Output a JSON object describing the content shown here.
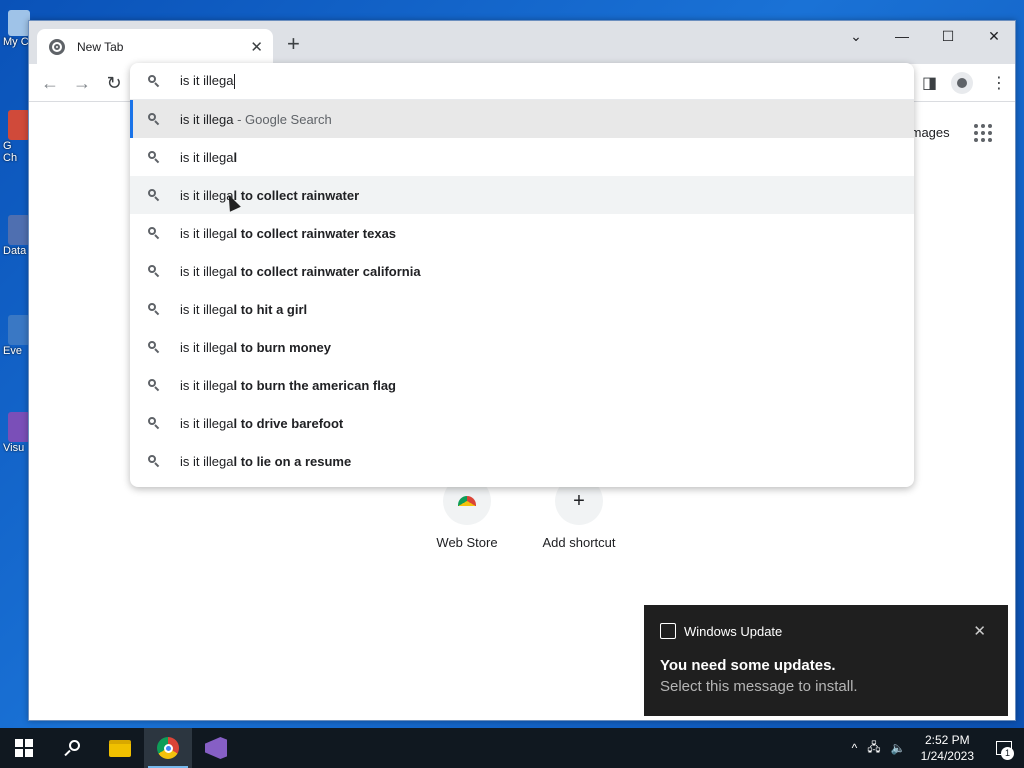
{
  "desktop": {
    "icons": [
      {
        "label": "My C"
      },
      {
        "label": "G\nCh"
      },
      {
        "label": "Data"
      },
      {
        "label": "Eve"
      },
      {
        "label": "Visu"
      }
    ]
  },
  "browser": {
    "tab_title": "New Tab",
    "tab_close": "✕",
    "new_tab": "+",
    "window_controls": {
      "tabsearch": "⌄",
      "minimize": "—",
      "maximize": "☐",
      "close": "✕"
    },
    "omnibox_query": "is it illega",
    "images_link": "Images",
    "shortcuts": [
      {
        "label": "Web Store",
        "icon": "webstore-icon"
      },
      {
        "label": "Add shortcut",
        "icon": "plus-icon",
        "glyph": "+"
      }
    ]
  },
  "suggestions": [
    {
      "typed": "is it illega",
      "rest": "",
      "suffix": " - Google Search",
      "state": "selected"
    },
    {
      "typed": "is it illega",
      "rest": "l",
      "suffix": "",
      "state": ""
    },
    {
      "typed": "is it illega",
      "rest": "l to collect rainwater",
      "suffix": "",
      "state": "hover"
    },
    {
      "typed": "is it illega",
      "rest": "l to collect rainwater texas",
      "suffix": "",
      "state": ""
    },
    {
      "typed": "is it illega",
      "rest": "l to collect rainwater california",
      "suffix": "",
      "state": ""
    },
    {
      "typed": "is it illega",
      "rest": "l to hit a girl",
      "suffix": "",
      "state": ""
    },
    {
      "typed": "is it illega",
      "rest": "l to burn money",
      "suffix": "",
      "state": ""
    },
    {
      "typed": "is it illega",
      "rest": "l to burn the american flag",
      "suffix": "",
      "state": ""
    },
    {
      "typed": "is it illega",
      "rest": "l to drive barefoot",
      "suffix": "",
      "state": ""
    },
    {
      "typed": "is it illega",
      "rest": "l to lie on a resume",
      "suffix": "",
      "state": ""
    }
  ],
  "toast": {
    "app": "Windows Update",
    "close": "✕",
    "title": "You need some updates.",
    "body": "Select this message to install."
  },
  "taskbar": {
    "time": "2:52 PM",
    "date": "1/24/2023",
    "notification_count": "1",
    "tray_chevron": "^"
  }
}
